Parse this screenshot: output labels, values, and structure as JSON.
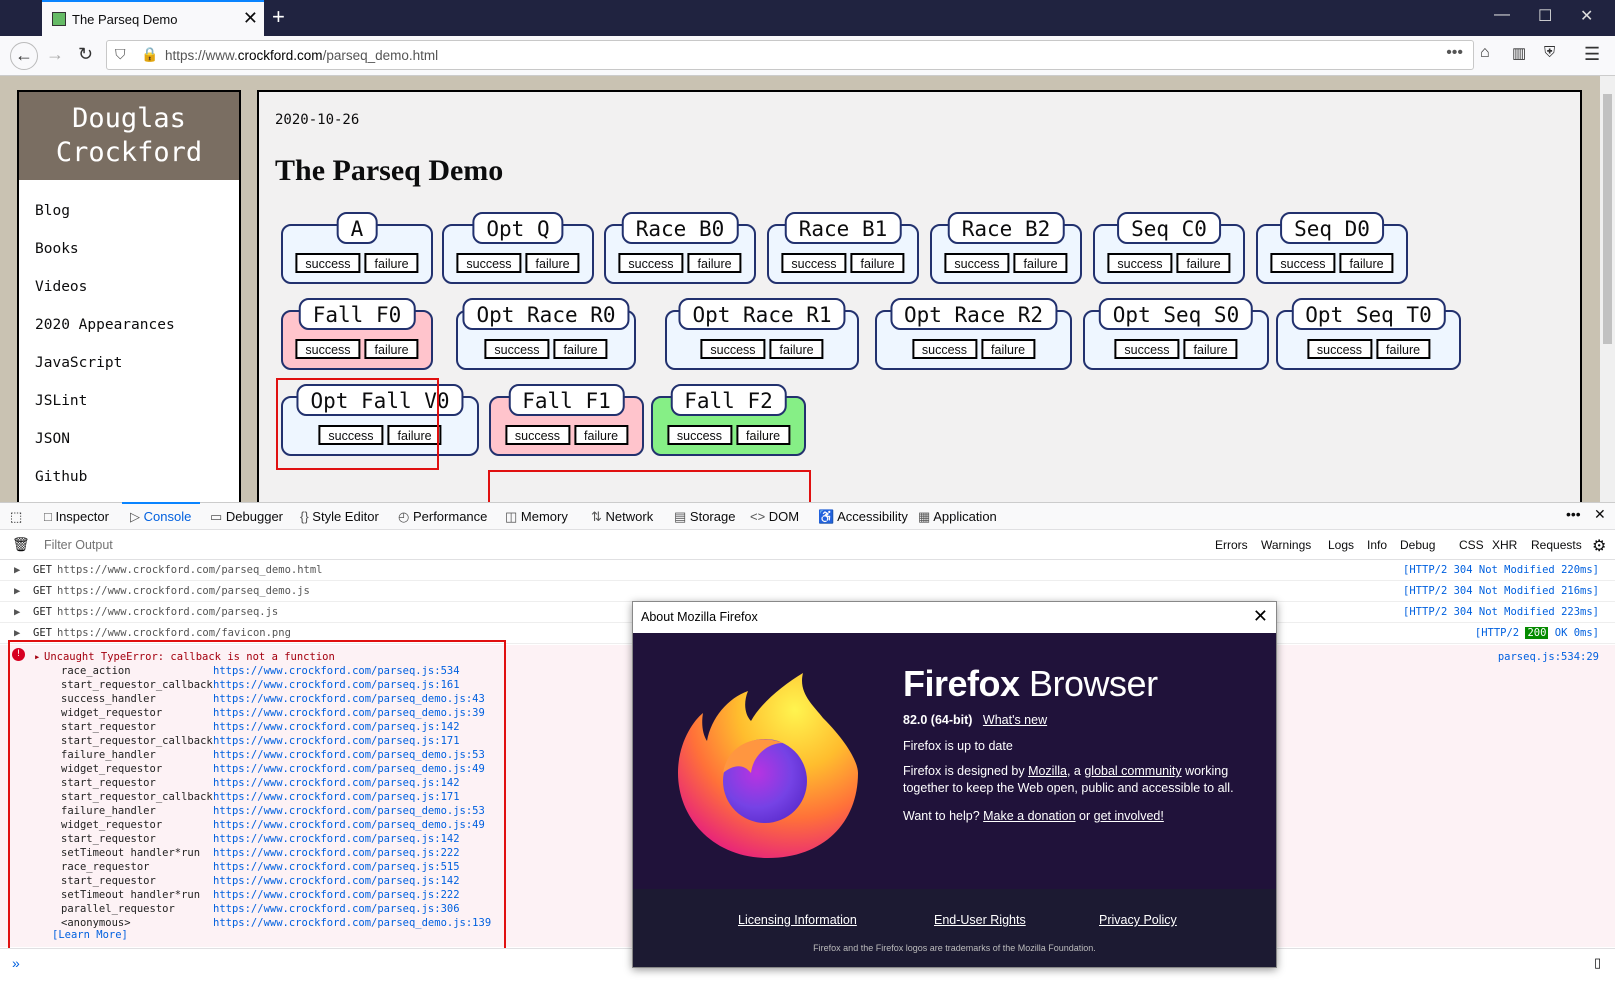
{
  "browser": {
    "tab_title": "The Parseq Demo",
    "url_prefix": "https://www.",
    "url_domain": "crockford.com",
    "url_path": "/parseq_demo.html"
  },
  "site": {
    "logo_line1": "Douglas",
    "logo_line2": "Crockford",
    "nav": [
      "Blog",
      "Books",
      "Videos",
      "2020 Appearances",
      "JavaScript",
      "JSLint",
      "JSON",
      "Github"
    ]
  },
  "page": {
    "date": "2020-10-26",
    "title": "The Parseq Demo",
    "boxes": [
      {
        "label": "A",
        "state": "normal"
      },
      {
        "label": "Opt Q",
        "state": "normal"
      },
      {
        "label": "Race B0",
        "state": "normal"
      },
      {
        "label": "Race B1",
        "state": "normal"
      },
      {
        "label": "Race B2",
        "state": "normal"
      },
      {
        "label": "Seq C0",
        "state": "normal"
      },
      {
        "label": "Seq D0",
        "state": "normal"
      },
      {
        "label": "Fall F0",
        "state": "fail"
      },
      {
        "label": "Opt Race R0",
        "state": "normal"
      },
      {
        "label": "Opt Race R1",
        "state": "normal"
      },
      {
        "label": "Opt Race R2",
        "state": "normal"
      },
      {
        "label": "Opt Seq S0",
        "state": "normal"
      },
      {
        "label": "Opt Seq T0",
        "state": "normal"
      },
      {
        "label": "Opt Fall V0",
        "state": "normal"
      },
      {
        "label": "Fall F1",
        "state": "fail"
      },
      {
        "label": "Fall F2",
        "state": "ok"
      }
    ],
    "success_label": "success",
    "failure_label": "failure"
  },
  "devtools": {
    "tabs": [
      "Inspector",
      "Console",
      "Debugger",
      "Style Editor",
      "Performance",
      "Memory",
      "Network",
      "Storage",
      "DOM",
      "Accessibility",
      "Application"
    ],
    "filter_placeholder": "Filter Output",
    "filter_buttons": [
      "Errors",
      "Warnings",
      "Logs",
      "Info",
      "Debug",
      "CSS",
      "XHR",
      "Requests"
    ],
    "requests": [
      {
        "method": "GET",
        "url": "https://www.crockford.com/parseq_demo.html",
        "status": "[HTTP/2 304 Not Modified 220ms]"
      },
      {
        "method": "GET",
        "url": "https://www.crockford.com/parseq_demo.js",
        "status": "[HTTP/2 304 Not Modified 216ms]"
      },
      {
        "method": "GET",
        "url": "https://www.crockford.com/parseq.js",
        "status": "[HTTP/2 304 Not Modified 223ms]"
      },
      {
        "method": "GET",
        "url": "https://www.crockford.com/favicon.png",
        "status_pre": "[HTTP/2 ",
        "status_code": "200",
        "status_post": " OK 0ms]"
      }
    ],
    "error_message": "Uncaught TypeError: callback is not a function",
    "error_source": "parseq.js:534:29",
    "stack": [
      [
        "race_action",
        "https://www.crockford.com/parseq.js:534"
      ],
      [
        "start_requestor_callback",
        "https://www.crockford.com/parseq.js:161"
      ],
      [
        "success_handler",
        "https://www.crockford.com/parseq_demo.js:43"
      ],
      [
        "widget_requestor",
        "https://www.crockford.com/parseq_demo.js:39"
      ],
      [
        "start_requestor",
        "https://www.crockford.com/parseq.js:142"
      ],
      [
        "start_requestor_callback",
        "https://www.crockford.com/parseq.js:171"
      ],
      [
        "failure_handler",
        "https://www.crockford.com/parseq_demo.js:53"
      ],
      [
        "widget_requestor",
        "https://www.crockford.com/parseq_demo.js:49"
      ],
      [
        "start_requestor",
        "https://www.crockford.com/parseq.js:142"
      ],
      [
        "start_requestor_callback",
        "https://www.crockford.com/parseq.js:171"
      ],
      [
        "failure_handler",
        "https://www.crockford.com/parseq_demo.js:53"
      ],
      [
        "widget_requestor",
        "https://www.crockford.com/parseq_demo.js:49"
      ],
      [
        "start_requestor",
        "https://www.crockford.com/parseq.js:142"
      ],
      [
        "setTimeout handler*run",
        "https://www.crockford.com/parseq.js:222"
      ],
      [
        "race_requestor",
        "https://www.crockford.com/parseq.js:515"
      ],
      [
        "start_requestor",
        "https://www.crockford.com/parseq.js:142"
      ],
      [
        "setTimeout handler*run",
        "https://www.crockford.com/parseq.js:222"
      ],
      [
        "parallel_requestor",
        "https://www.crockford.com/parseq.js:306"
      ],
      [
        "<anonymous>",
        "https://www.crockford.com/parseq_demo.js:139"
      ]
    ],
    "learn_more": "[Learn More]"
  },
  "about": {
    "title": "About Mozilla Firefox",
    "brand_bold": "Firefox",
    "brand_rest": " Browser",
    "version": "82.0 (64-bit)",
    "whats_new": "What's new",
    "uptodate": "Firefox is up to date",
    "designed_pre": "Firefox is designed by ",
    "mozilla": "Mozilla",
    "designed_mid": ", a ",
    "community": "global community",
    "designed_post": " working",
    "designed_line2": "together to keep the Web open, public and accessible to all.",
    "help_pre": "Want to help? ",
    "donation": "Make a donation",
    "help_or": " or ",
    "involved": "get involved!",
    "licensing": "Licensing Information",
    "rights": "End-User Rights",
    "privacy": "Privacy Policy",
    "trademark": "Firefox and the Firefox logos are trademarks of the Mozilla Foundation."
  }
}
